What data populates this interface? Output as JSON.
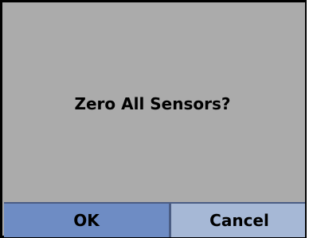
{
  "dialog": {
    "message": "Zero All Sensors?",
    "ok_label": "OK",
    "cancel_label": "Cancel"
  },
  "colors": {
    "background": "#ababab",
    "ok_button": "#6e8cc4",
    "cancel_button": "#a6b8d6",
    "text": "#000000"
  }
}
